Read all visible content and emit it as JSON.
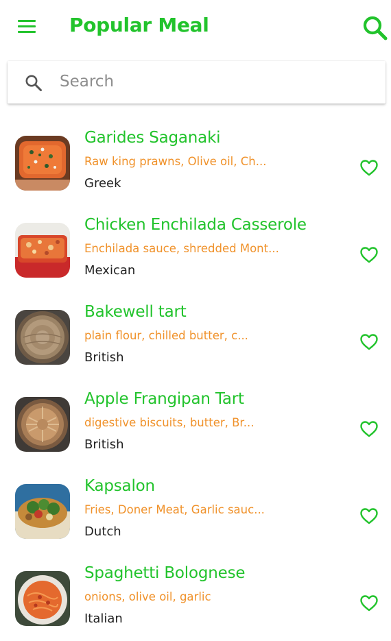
{
  "colors": {
    "accent": "#22c32c",
    "ingredients": "#f0922b",
    "text": "#222222",
    "placeholder": "#8d8d8d"
  },
  "header": {
    "title": "Popular Meal",
    "menu_icon": "hamburger-menu-icon",
    "search_icon": "search-icon"
  },
  "search": {
    "placeholder": "Search",
    "value": "",
    "icon": "search-icon"
  },
  "meals": [
    {
      "name": "Garides Saganaki",
      "ingredients": "Raw king prawns, Olive oil, Ch...",
      "cuisine": "Greek",
      "favorite_icon": "heart-outline-icon"
    },
    {
      "name": "Chicken Enchilada Casserole",
      "ingredients": "Enchilada sauce, shredded Mont...",
      "cuisine": "Mexican",
      "favorite_icon": "heart-outline-icon"
    },
    {
      "name": "Bakewell tart",
      "ingredients": "plain flour, chilled butter, c...",
      "cuisine": "British",
      "favorite_icon": "heart-outline-icon"
    },
    {
      "name": "Apple Frangipan Tart",
      "ingredients": "digestive biscuits, butter, Br...",
      "cuisine": "British",
      "favorite_icon": "heart-outline-icon"
    },
    {
      "name": "Kapsalon",
      "ingredients": "Fries, Doner Meat, Garlic sauc...",
      "cuisine": "Dutch",
      "favorite_icon": "heart-outline-icon"
    },
    {
      "name": "Spaghetti Bolognese",
      "ingredients": "onions, olive oil, garlic",
      "cuisine": "Italian",
      "favorite_icon": "heart-outline-icon"
    }
  ]
}
